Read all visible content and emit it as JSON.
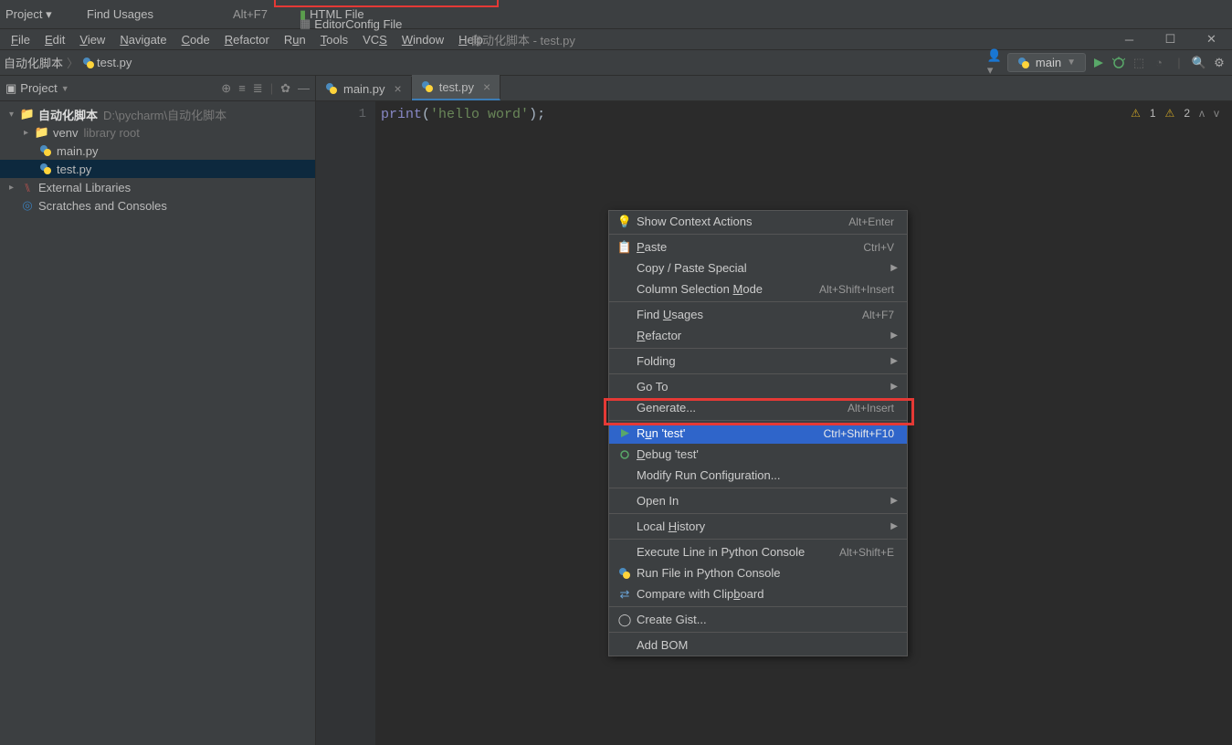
{
  "top_fragments": {
    "find_usages": "Find Usages",
    "find_usages_sc": "Alt+F7",
    "html_file": "HTML File",
    "editorconfig": "EditorConfig File",
    "project_label": "Project ▾"
  },
  "menu": {
    "file": "File",
    "edit": "Edit",
    "view": "View",
    "navigate": "Navigate",
    "code": "Code",
    "refactor": "Refactor",
    "run": "Run",
    "tools": "Tools",
    "vcs": "VCS",
    "window": "Window",
    "help": "Help"
  },
  "title": "自动化脚本 - test.py",
  "breadcrumb": {
    "root": "自动化脚本",
    "file": "test.py"
  },
  "run_config": "main",
  "tool_window": {
    "title": "Project"
  },
  "tree": {
    "root": "自动化脚本",
    "root_path": "D:\\pycharm\\自动化脚本",
    "venv": "venv",
    "venv_note": "library root",
    "main": "main.py",
    "test": "test.py",
    "ext": "External Libraries",
    "scratch": "Scratches and Consoles"
  },
  "tabs": {
    "main": "main.py",
    "test": "test.py"
  },
  "editor": {
    "line": "1",
    "code_kw": "print",
    "code_open": "(",
    "code_str": "'hello word'",
    "code_close": ");"
  },
  "inspections": {
    "err_count": "1",
    "warn_count": "2"
  },
  "context_menu": {
    "show_ctx": "Show Context Actions",
    "show_ctx_sc": "Alt+Enter",
    "paste": "Paste",
    "paste_sc": "Ctrl+V",
    "copy_special": "Copy / Paste Special",
    "col_sel": "Column Selection Mode",
    "col_sel_sc": "Alt+Shift+Insert",
    "find_usages": "Find Usages",
    "find_usages_sc": "Alt+F7",
    "refactor": "Refactor",
    "folding": "Folding",
    "goto": "Go To",
    "generate": "Generate...",
    "generate_sc": "Alt+Insert",
    "run": "Run 'test'",
    "run_sc": "Ctrl+Shift+F10",
    "debug": "Debug 'test'",
    "modify_run": "Modify Run Configuration...",
    "open_in": "Open In",
    "local_hist": "Local History",
    "exec_line": "Execute Line in Python Console",
    "exec_line_sc": "Alt+Shift+E",
    "run_console": "Run File in Python Console",
    "cmp_clip": "Compare with Clipboard",
    "gist": "Create Gist...",
    "bom": "Add BOM"
  }
}
